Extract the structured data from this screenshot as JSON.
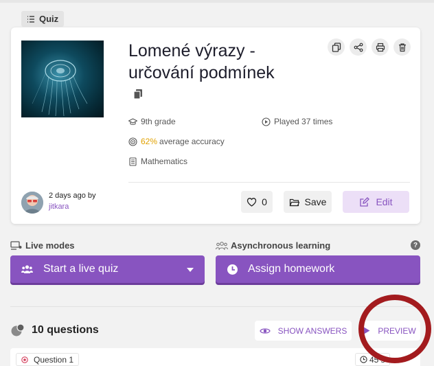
{
  "quiz": {
    "type_label": "Quiz",
    "title": "Lomené výrazy - určování podmínek",
    "grade": "9th grade",
    "played": "Played 37 times",
    "accuracy_value": "62%",
    "accuracy_label": "average accuracy",
    "subject": "Mathematics"
  },
  "author": {
    "line1": "2 days ago by",
    "name": "jitkara"
  },
  "card_actions": {
    "like_count": "0",
    "save_label": "Save",
    "edit_label": "Edit"
  },
  "modes": {
    "live_label": "Live modes",
    "async_label": "Asynchronous learning",
    "help": "?",
    "start_live_label": "Start a live quiz",
    "assign_label": "Assign homework"
  },
  "questions": {
    "count_label": "10 questions",
    "show_answers_label": "SHOW ANSWERS",
    "preview_label": "PREVIEW",
    "first_label": "Question 1",
    "first_time": "45 s"
  },
  "colors": {
    "accent": "#8854c0",
    "accuracy": "#e1a100",
    "highlight": "#a31b1e"
  },
  "icons": [
    "list-icon",
    "copy-icon",
    "share-icon",
    "print-icon",
    "trash-icon",
    "graduation-cap-icon",
    "play-circle-icon",
    "target-icon",
    "book-icon",
    "heart-icon",
    "folder-icon",
    "edit-icon",
    "people-icon",
    "clock-icon",
    "eye-icon",
    "play-icon",
    "help-icon"
  ]
}
